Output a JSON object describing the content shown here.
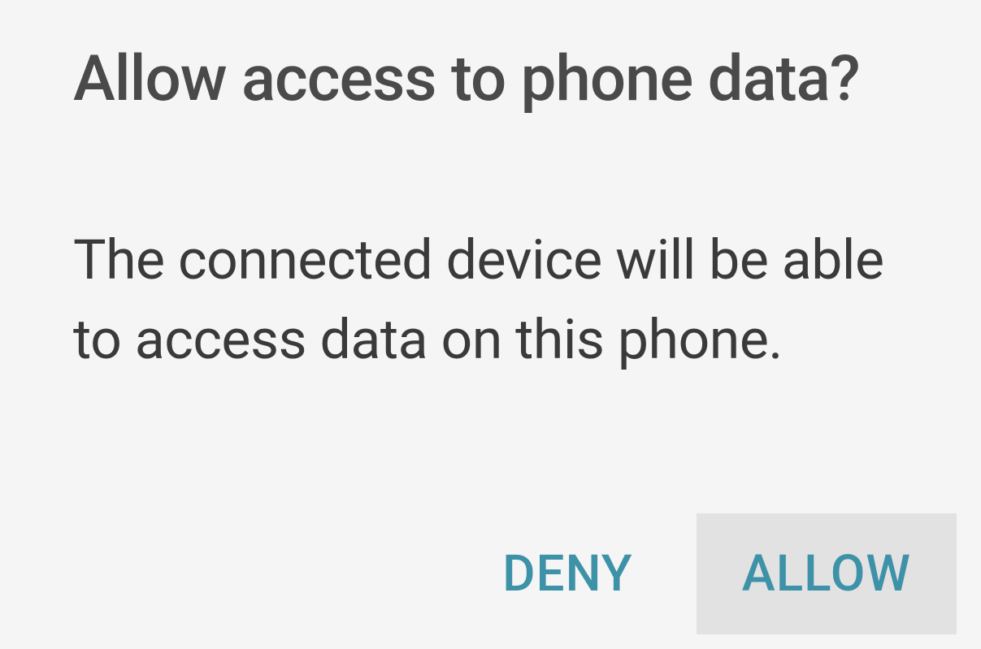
{
  "dialog": {
    "title": "Allow access to phone data?",
    "body": "The connected device will be able to access data on this phone.",
    "deny_label": "DENY",
    "allow_label": "ALLOW"
  }
}
